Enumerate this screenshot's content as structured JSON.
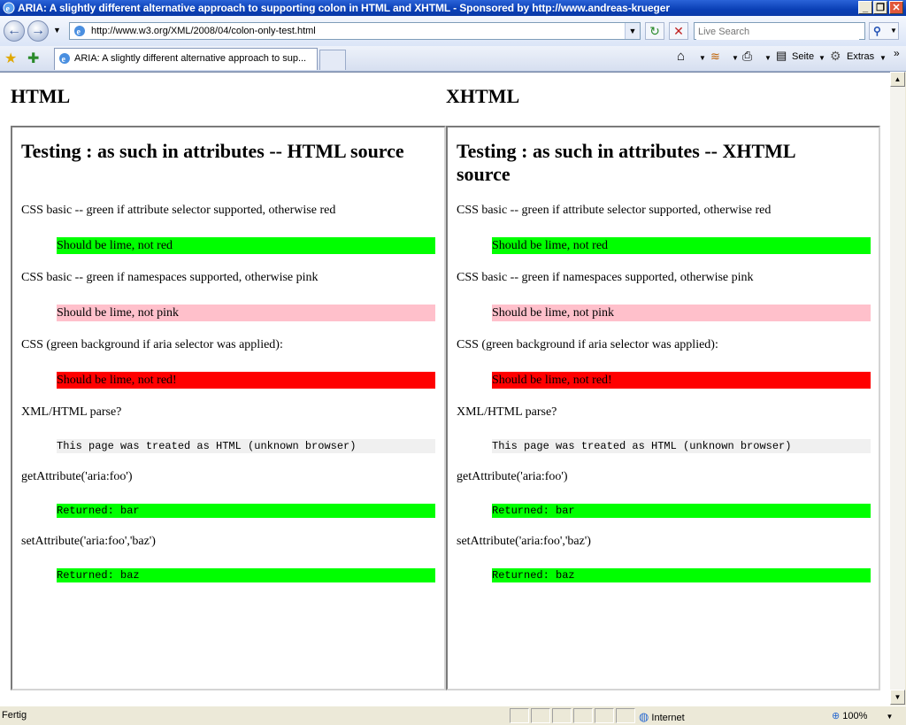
{
  "window": {
    "title": "ARIA: A slightly different alternative approach to supporting colon in HTML and XHTML - Sponsored by http://www.andreas-krueger",
    "minimize": "_",
    "restore": "❐",
    "close": "✕"
  },
  "nav": {
    "back": "←",
    "forward": "→",
    "url": "http://www.w3.org/XML/2008/04/colon-only-test.html",
    "refresh": "↻",
    "stop": "✕",
    "search_placeholder": "Live Search",
    "search_glyph": "⚲"
  },
  "tabs": {
    "active_title": "ARIA: A slightly different alternative approach to sup...",
    "commands": {
      "page": "Seite",
      "tools": "Extras",
      "more": "»"
    }
  },
  "page": {
    "columns": [
      {
        "heading": "HTML",
        "frame_title": "Testing : as such in attributes -- HTML source",
        "tests": [
          {
            "label": "CSS basic -- green if attribute selector supported, otherwise red",
            "result": "Should be lime, not red",
            "bg": "#00ff00",
            "mono": false
          },
          {
            "label": "CSS basic -- green if namespaces supported, otherwise pink",
            "result": "Should be lime, not pink",
            "bg": "#ffc0cb",
            "mono": false
          },
          {
            "label": "CSS (green background if aria selector was applied):",
            "result": "Should be lime, not red!",
            "bg": "#ff0000",
            "mono": false
          },
          {
            "label": "XML/HTML parse?",
            "result": "This page was treated as HTML (unknown browser)",
            "bg": "#f0f0f0",
            "mono": true
          },
          {
            "label": "getAttribute('aria:foo')",
            "result": "Returned: bar",
            "bg": "#00ff00",
            "mono": true
          },
          {
            "label": "setAttribute('aria:foo','baz')",
            "result": "Returned: baz",
            "bg": "#00ff00",
            "mono": true
          }
        ]
      },
      {
        "heading": "XHTML",
        "frame_title": "Testing : as such in attributes -- XHTML source",
        "tests": [
          {
            "label": "CSS basic -- green if attribute selector supported, otherwise red",
            "result": "Should be lime, not red",
            "bg": "#00ff00",
            "mono": false
          },
          {
            "label": "CSS basic -- green if namespaces supported, otherwise pink",
            "result": "Should be lime, not pink",
            "bg": "#ffc0cb",
            "mono": false
          },
          {
            "label": "CSS (green background if aria selector was applied):",
            "result": "Should be lime, not red!",
            "bg": "#ff0000",
            "mono": false
          },
          {
            "label": "XML/HTML parse?",
            "result": "This page was treated as HTML (unknown browser)",
            "bg": "#f0f0f0",
            "mono": true
          },
          {
            "label": "getAttribute('aria:foo')",
            "result": "Returned: bar",
            "bg": "#00ff00",
            "mono": true
          },
          {
            "label": "setAttribute('aria:foo','baz')",
            "result": "Returned: baz",
            "bg": "#00ff00",
            "mono": true
          }
        ]
      }
    ]
  },
  "status": {
    "text": "Fertig",
    "zone": "Internet",
    "zoom": "100%"
  },
  "colors": {
    "lime": "#00ff00",
    "pink": "#ffc0cb",
    "red": "#ff0000",
    "titlebar": "#0a3fb5"
  }
}
